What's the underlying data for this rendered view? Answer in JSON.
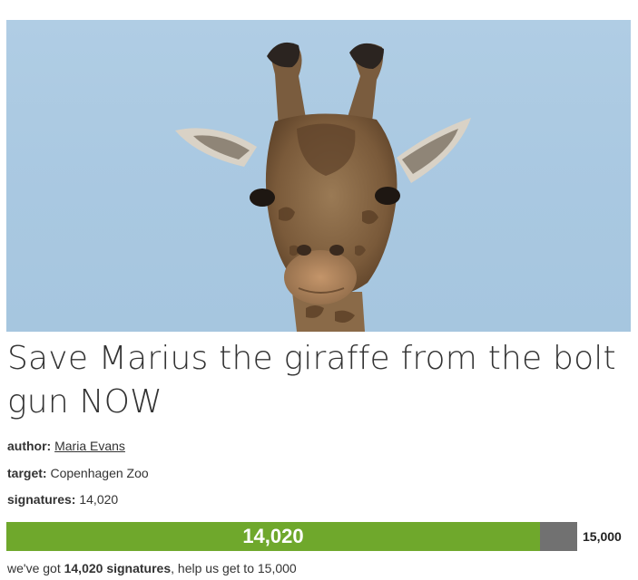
{
  "petition": {
    "title": "Save Marius the giraffe from the bolt gun NOW",
    "author_label": "author:",
    "author_name": "Maria Evans",
    "target_label": "target:",
    "target_name": "Copenhagen Zoo",
    "signatures_label": "signatures:",
    "signatures_value": "14,020"
  },
  "progress": {
    "current": "14,020",
    "goal": "15,000",
    "fraction": 0.9347
  },
  "summary": {
    "prefix": "we've got",
    "count": "14,020",
    "unit": "signatures",
    "suffix": ", help us get to 15,000"
  },
  "colors": {
    "progress_fill": "#6fa82c",
    "progress_track": "#717171",
    "sky": "#aac8e1"
  }
}
